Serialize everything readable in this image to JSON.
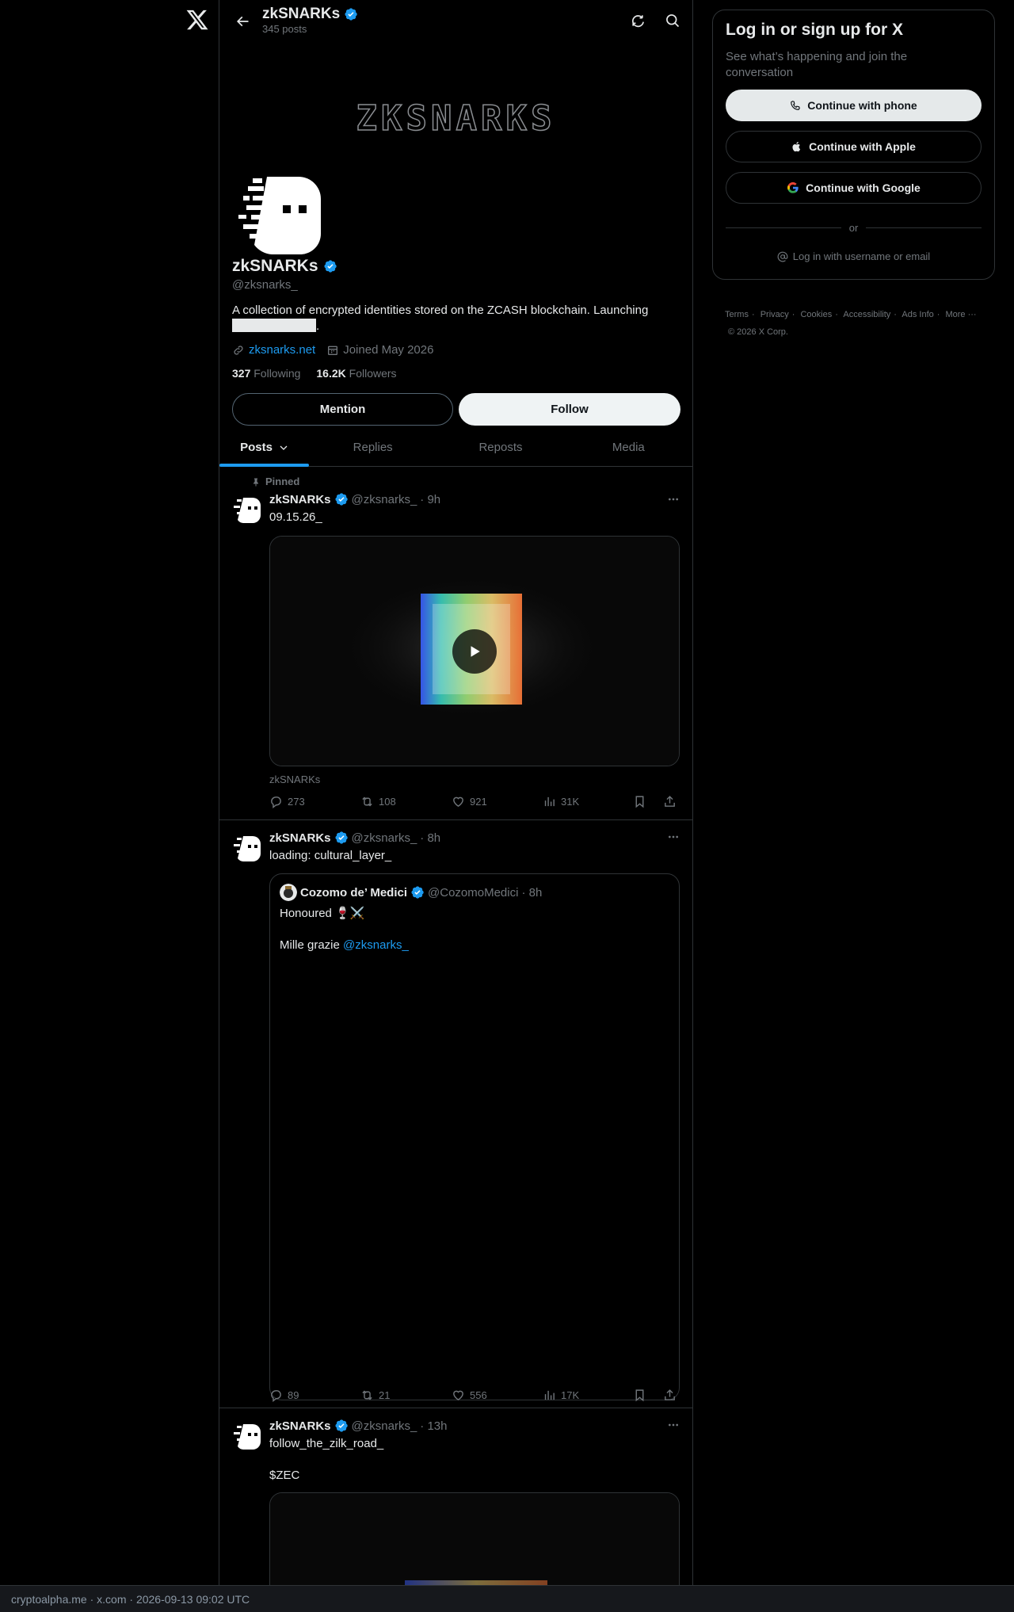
{
  "header": {
    "name": "zkSNARKs",
    "posts_count": "345 posts"
  },
  "banner": {
    "text": "ZKSNARKS"
  },
  "profile": {
    "name": "zkSNARKs",
    "handle": "@zksnarks_",
    "bio": "A collection of encrypted identities stored on the ZCASH blockchain. Launching",
    "bio_end": ".",
    "website": "zksnarks.net",
    "joined": "Joined May 2026",
    "following_count": "327",
    "following_label": "Following",
    "followers_count": "16.2K",
    "followers_label": "Followers",
    "mention_label": "Mention",
    "follow_label": "Follow"
  },
  "tabs": [
    {
      "label": "Posts"
    },
    {
      "label": "Replies"
    },
    {
      "label": "Reposts"
    },
    {
      "label": "Media"
    }
  ],
  "posts": [
    {
      "pinned_label": "Pinned",
      "name": "zkSNARKs",
      "handle": "@zksnarks_",
      "time": "· 9h",
      "text": "09.15.26_",
      "caption": "zkSNARKs",
      "replies": "273",
      "reposts": "108",
      "likes": "921",
      "views": "31K"
    },
    {
      "name": "zkSNARKs",
      "handle": "@zksnarks_",
      "time": "· 8h",
      "text": "loading: cultural_layer_",
      "quote": {
        "name": "Cozomo de’ Medici",
        "handle": "@CozomoMedici",
        "time": "· 8h",
        "line1": "Honoured 🍷⚔️",
        "line2": "Mille grazie",
        "mention": "@zksnarks_"
      },
      "replies": "89",
      "reposts": "21",
      "likes": "556",
      "views": "17K"
    },
    {
      "name": "zkSNARKs",
      "handle": "@zksnarks_",
      "time": "· 13h",
      "text": "follow_the_zilk_road_",
      "cashtag": "$ZEC"
    }
  ],
  "signup": {
    "title": "Log in or sign up for X",
    "subtitle": "See what’s happening and join the conversation",
    "phone_label": "Continue with phone",
    "apple_label": "Continue with Apple",
    "google_label": "Continue with Google",
    "or_label": "or",
    "login_label": "Log in with username or email"
  },
  "footer": {
    "links": [
      "Terms",
      "Privacy",
      "Cookies",
      "Accessibility",
      "Ads Info",
      "More ···"
    ],
    "copyright": "© 2026 X Corp."
  },
  "statusbar": {
    "text": "cryptoalpha.me · x.com · 2026-09-13 09:02 UTC"
  },
  "colors": {
    "accent": "#1d9bf0",
    "background": "#000000",
    "border": "#2f3336",
    "muted": "#71767b"
  }
}
